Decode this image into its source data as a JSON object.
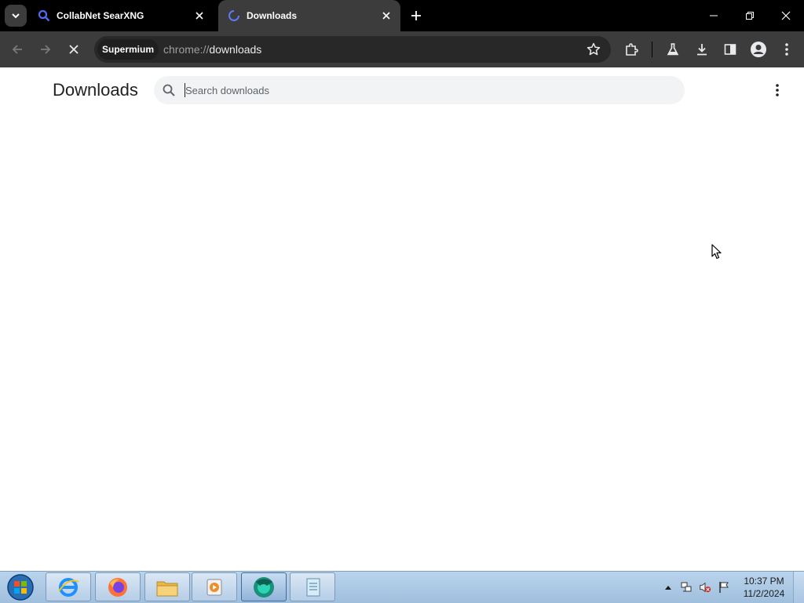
{
  "browser": {
    "tabs": [
      {
        "title": "CollabNet SearXNG",
        "favicon": "magnifier-icon",
        "active": false
      },
      {
        "title": "Downloads",
        "favicon": "loading-spinner-icon",
        "active": true
      }
    ],
    "address_chip": "Supermium",
    "url_scheme": "chrome://",
    "url_host": "downloads",
    "accent": "#3c3c3c"
  },
  "page": {
    "title": "Downloads",
    "search_placeholder": "Search downloads",
    "search_value": ""
  },
  "taskbar": {
    "apps": [
      "internet-explorer-icon",
      "firefox-icon",
      "file-explorer-icon",
      "media-player-icon",
      "supermium-icon",
      "notepad-icon"
    ],
    "clock_time": "10:37 PM",
    "clock_date": "11/2/2024"
  }
}
